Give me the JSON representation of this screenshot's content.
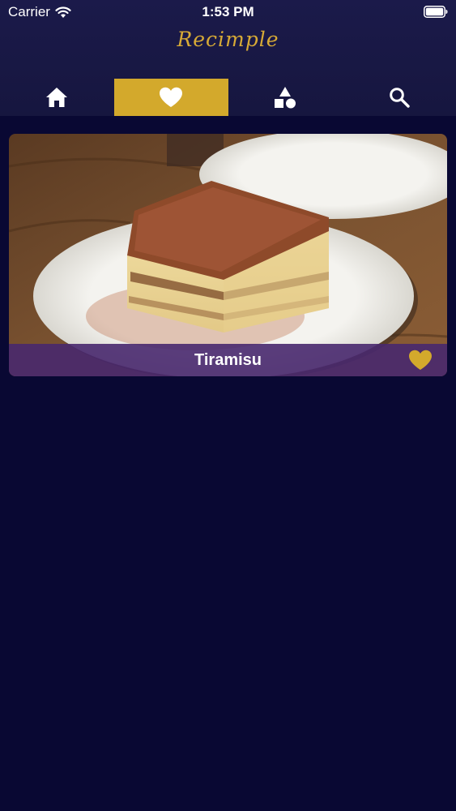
{
  "status_bar": {
    "carrier": "Carrier",
    "time": "1:53 PM",
    "wifi_icon": "wifi-icon",
    "battery_icon": "battery-icon"
  },
  "header": {
    "app_name": "Recimple"
  },
  "tabs": [
    {
      "name": "home",
      "icon": "home-icon",
      "active": false
    },
    {
      "name": "favorites",
      "icon": "heart-icon",
      "active": true
    },
    {
      "name": "categories",
      "icon": "shapes-icon",
      "active": false
    },
    {
      "name": "search",
      "icon": "search-icon",
      "active": false
    }
  ],
  "recipes": [
    {
      "title": "Tiramisu",
      "favorited": true
    }
  ],
  "colors": {
    "background": "#090833",
    "header": "#1b1a4a",
    "accent": "#d3a92c",
    "caption_bar": "#48286e"
  }
}
